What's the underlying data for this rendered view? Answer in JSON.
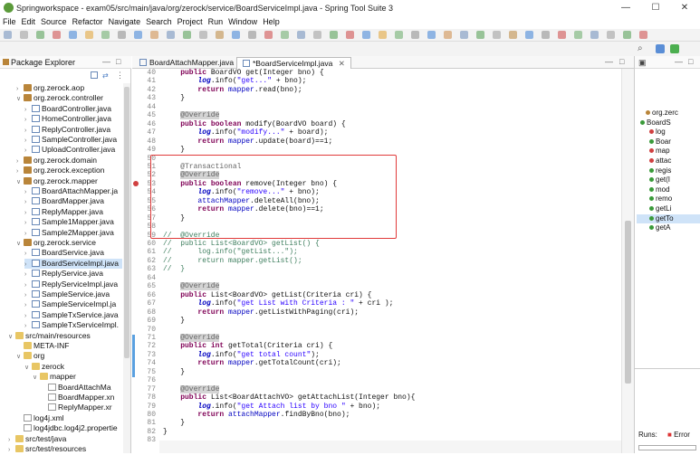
{
  "window": {
    "title": "Springworkspace - exam05/src/main/java/org/zerock/service/BoardServiceImpl.java - Spring Tool Suite 3",
    "minimize": "—",
    "maximize": "☐",
    "close": "✕"
  },
  "menu": [
    "File",
    "Edit",
    "Source",
    "Refactor",
    "Navigate",
    "Search",
    "Project",
    "Run",
    "Window",
    "Help"
  ],
  "package_explorer": {
    "title": "Package Explorer",
    "tree": [
      {
        "label": "org.zerock.aop",
        "type": "pkg",
        "indent": 2,
        "arrow": ">"
      },
      {
        "label": "org.zerock.controller",
        "type": "pkg",
        "indent": 2,
        "arrow": "v"
      },
      {
        "label": "BoardController.java",
        "type": "java",
        "indent": 3,
        "arrow": ">"
      },
      {
        "label": "HomeController.java",
        "type": "java",
        "indent": 3,
        "arrow": ">"
      },
      {
        "label": "ReplyController.java",
        "type": "java",
        "indent": 3,
        "arrow": ">"
      },
      {
        "label": "SampleController.java",
        "type": "java",
        "indent": 3,
        "arrow": ">"
      },
      {
        "label": "UploadController.java",
        "type": "java",
        "indent": 3,
        "arrow": ">"
      },
      {
        "label": "org.zerock.domain",
        "type": "pkg",
        "indent": 2,
        "arrow": ">"
      },
      {
        "label": "org.zerock.exception",
        "type": "pkg",
        "indent": 2,
        "arrow": ">"
      },
      {
        "label": "org.zerock.mapper",
        "type": "pkg",
        "indent": 2,
        "arrow": "v"
      },
      {
        "label": "BoardAttachMapper.ja",
        "type": "java",
        "indent": 3,
        "arrow": ">"
      },
      {
        "label": "BoardMapper.java",
        "type": "java",
        "indent": 3,
        "arrow": ">"
      },
      {
        "label": "ReplyMapper.java",
        "type": "java",
        "indent": 3,
        "arrow": ">"
      },
      {
        "label": "Sample1Mapper.java",
        "type": "java",
        "indent": 3,
        "arrow": ">"
      },
      {
        "label": "Sample2Mapper.java",
        "type": "java",
        "indent": 3,
        "arrow": ">"
      },
      {
        "label": "org.zerock.service",
        "type": "pkg",
        "indent": 2,
        "arrow": "v"
      },
      {
        "label": "BoardService.java",
        "type": "java",
        "indent": 3,
        "arrow": ">"
      },
      {
        "label": "BoardServiceImpl.java",
        "type": "java",
        "indent": 3,
        "arrow": ">",
        "selected": true
      },
      {
        "label": "ReplyService.java",
        "type": "java",
        "indent": 3,
        "arrow": ">"
      },
      {
        "label": "ReplyServiceImpl.java",
        "type": "java",
        "indent": 3,
        "arrow": ">"
      },
      {
        "label": "SampleService.java",
        "type": "java",
        "indent": 3,
        "arrow": ">"
      },
      {
        "label": "SampleServiceImpl.ja",
        "type": "java",
        "indent": 3,
        "arrow": ">"
      },
      {
        "label": "SampleTxService.java",
        "type": "java",
        "indent": 3,
        "arrow": ">"
      },
      {
        "label": "SampleTxServiceImpl.",
        "type": "java",
        "indent": 3,
        "arrow": ">"
      },
      {
        "label": "src/main/resources",
        "type": "folder",
        "indent": 1,
        "arrow": "v"
      },
      {
        "label": "META-INF",
        "type": "folder",
        "indent": 2,
        "arrow": ""
      },
      {
        "label": "org",
        "type": "folder",
        "indent": 2,
        "arrow": "v"
      },
      {
        "label": "zerock",
        "type": "folder",
        "indent": 3,
        "arrow": "v"
      },
      {
        "label": "mapper",
        "type": "folder",
        "indent": 4,
        "arrow": "v"
      },
      {
        "label": "BoardAttachMa",
        "type": "xml",
        "indent": 5,
        "arrow": ""
      },
      {
        "label": "BoardMapper.xn",
        "type": "xml",
        "indent": 5,
        "arrow": ""
      },
      {
        "label": "ReplyMapper.xr",
        "type": "xml",
        "indent": 5,
        "arrow": ""
      },
      {
        "label": "log4j.xml",
        "type": "xml",
        "indent": 2,
        "arrow": ""
      },
      {
        "label": "log4jdbc.log4j2.propertie",
        "type": "xml",
        "indent": 2,
        "arrow": ""
      },
      {
        "label": "src/test/java",
        "type": "folder",
        "indent": 1,
        "arrow": ">"
      },
      {
        "label": "src/test/resources",
        "type": "folder",
        "indent": 1,
        "arrow": ">"
      }
    ]
  },
  "editor": {
    "tabs": [
      {
        "label": "BoardAttachMapper.java",
        "active": false
      },
      {
        "label": "*BoardServiceImpl.java",
        "active": true
      }
    ],
    "lines": [
      {
        "n": "40",
        "html": "    <span class='kw'>public</span> BoardVO get(Integer bno) {"
      },
      {
        "n": "41",
        "html": "        <span class='it'>log</span>.info(<span class='str'>\"get...\"</span> + bno);"
      },
      {
        "n": "42",
        "html": "        <span class='kw'>return</span> <span class='fld'>mapper</span>.read(bno);"
      },
      {
        "n": "43",
        "html": "    }"
      },
      {
        "n": "44",
        "html": ""
      },
      {
        "n": "45",
        "html": "    <span class='ann anhl'>@Override</span>"
      },
      {
        "n": "46",
        "html": "    <span class='kw'>public</span> <span class='kw'>boolean</span> modify(BoardVO board) {"
      },
      {
        "n": "47",
        "html": "        <span class='it'>log</span>.info(<span class='str'>\"modify...\"</span> + board);"
      },
      {
        "n": "48",
        "html": "        <span class='kw'>return</span> <span class='fld'>mapper</span>.update(board)==1;"
      },
      {
        "n": "49",
        "html": "    }"
      },
      {
        "n": "50",
        "html": ""
      },
      {
        "n": "51",
        "html": "    <span class='ann'>@Transactional</span>"
      },
      {
        "n": "52",
        "html": "    <span class='ann anhl'>@Override</span>"
      },
      {
        "n": "53",
        "html": "    <span class='kw'>public</span> <span class='kw'>boolean</span> remove(Integer bno) {"
      },
      {
        "n": "54",
        "html": "        <span class='it'>log</span>.info(<span class='str'>\"remove...\"</span> + bno);"
      },
      {
        "n": "55",
        "html": "        <span class='fld'>attachMapper</span>.deleteAll(bno);"
      },
      {
        "n": "56",
        "html": "        <span class='kw'>return</span> <span class='fld'>mapper</span>.delete(bno)==1;"
      },
      {
        "n": "57",
        "html": "    }"
      },
      {
        "n": "58",
        "html": ""
      },
      {
        "n": "59",
        "html": "<span class='cmt'>//  @Override</span>"
      },
      {
        "n": "60",
        "html": "<span class='cmt'>//  public List&lt;BoardVO&gt; getList() {</span>"
      },
      {
        "n": "61",
        "html": "<span class='cmt'>//      log.info(\"getList...\");</span>"
      },
      {
        "n": "62",
        "html": "<span class='cmt'>//      return mapper.getList();</span>"
      },
      {
        "n": "63",
        "html": "<span class='cmt'>//  }</span>"
      },
      {
        "n": "64",
        "html": ""
      },
      {
        "n": "65",
        "html": "    <span class='ann anhl'>@Override</span>"
      },
      {
        "n": "66",
        "html": "    <span class='kw'>public</span> List&lt;BoardVO&gt; getList(Criteria cri) {"
      },
      {
        "n": "67",
        "html": "        <span class='it'>log</span>.info(<span class='str'>\"get List with Criteria : \"</span> + cri );"
      },
      {
        "n": "68",
        "html": "        <span class='kw'>return</span> <span class='fld'>mapper</span>.getListWithPaging(cri);"
      },
      {
        "n": "69",
        "html": "    }"
      },
      {
        "n": "70",
        "html": ""
      },
      {
        "n": "71",
        "html": "    <span class='ann anhl'>@Override</span>"
      },
      {
        "n": "72",
        "html": "    <span class='kw'>public</span> <span class='kw'>int</span> getTotal(Criteria cri) {"
      },
      {
        "n": "73",
        "html": "        <span class='it'>log</span>.info(<span class='str'>\"get total count\"</span>);"
      },
      {
        "n": "74",
        "html": "        <span class='kw'>return</span> <span class='fld'>mapper</span>.getTotalCount(cri);"
      },
      {
        "n": "75",
        "html": "    }"
      },
      {
        "n": "76",
        "html": ""
      },
      {
        "n": "77",
        "html": "    <span class='ann anhl'>@Override</span>"
      },
      {
        "n": "78",
        "html": "    <span class='kw'>public</span> List&lt;BoardAttachVO&gt; getAttachList(Integer bno){"
      },
      {
        "n": "79",
        "html": "        <span class='it'>log</span>.info(<span class='str'>\"get Attach list by bno \"</span> + bno);"
      },
      {
        "n": "80",
        "html": "        <span class='kw'>return</span> <span class='fld'>attachMapper</span>.findByBno(bno);"
      },
      {
        "n": "81",
        "html": "    }"
      },
      {
        "n": "82",
        "html": "}"
      },
      {
        "n": "83",
        "html": ""
      }
    ]
  },
  "outline": {
    "items": [
      {
        "label": "org.zerc",
        "icon": "pkg"
      },
      {
        "label": "BoardS",
        "icon": "class"
      },
      {
        "label": "log",
        "icon": "field"
      },
      {
        "label": "Boar",
        "icon": "ctor"
      },
      {
        "label": "map",
        "icon": "field"
      },
      {
        "label": "attac",
        "icon": "field"
      },
      {
        "label": "regis",
        "icon": "method"
      },
      {
        "label": "get(I",
        "icon": "method"
      },
      {
        "label": "mod",
        "icon": "method"
      },
      {
        "label": "remo",
        "icon": "method"
      },
      {
        "label": "getLi",
        "icon": "method"
      },
      {
        "label": "getTo",
        "icon": "method",
        "selected": true
      },
      {
        "label": "getA",
        "icon": "method"
      }
    ],
    "runs_label": "Runs:",
    "errors_label": "Error"
  },
  "colors": {
    "accent": "#2d6ec4",
    "selection": "#cfe3f8",
    "annotation_box": "#e03a3a"
  }
}
